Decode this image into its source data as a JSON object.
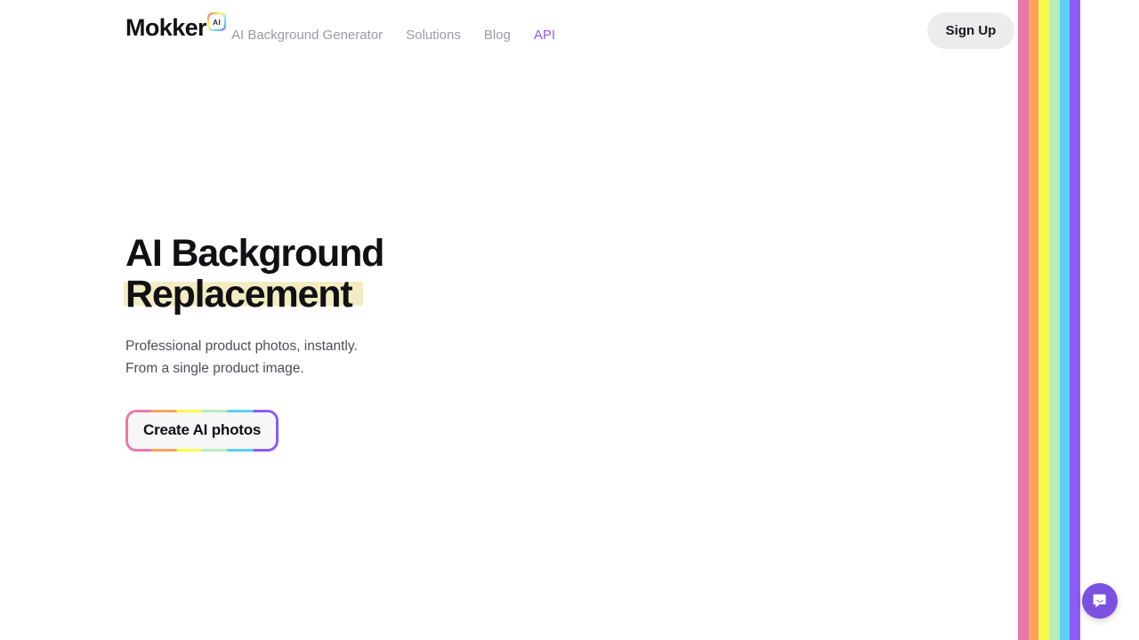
{
  "header": {
    "brand": {
      "word": "Mokker",
      "badge_label": "AI",
      "badge_icon": "ai-badge-icon"
    },
    "nav_items": [
      {
        "label": "AI Background Generator",
        "active": false
      },
      {
        "label": "Solutions",
        "active": false
      },
      {
        "label": "Blog",
        "active": false
      },
      {
        "label": "API",
        "active": true
      }
    ],
    "signup_label": "Sign Up"
  },
  "hero": {
    "headline_line1": "AI Background",
    "headline_line2": "Replacement",
    "subtitle_line1": "Professional product photos, instantly.",
    "subtitle_line2": "From a single product image.",
    "cta_label": "Create AI photos"
  },
  "decor": {
    "stripe_colors": [
      "#e879ac",
      "#fda35f",
      "#fafa4b",
      "#b4eec0",
      "#5cd0f5",
      "#8b5cf6"
    ],
    "highlight_color": "#f3ecc3",
    "accent_color": "#8b5cf6",
    "chat_bubble_color": "#7b52e0"
  },
  "chat": {
    "icon": "chat-bubble-smile-icon"
  }
}
